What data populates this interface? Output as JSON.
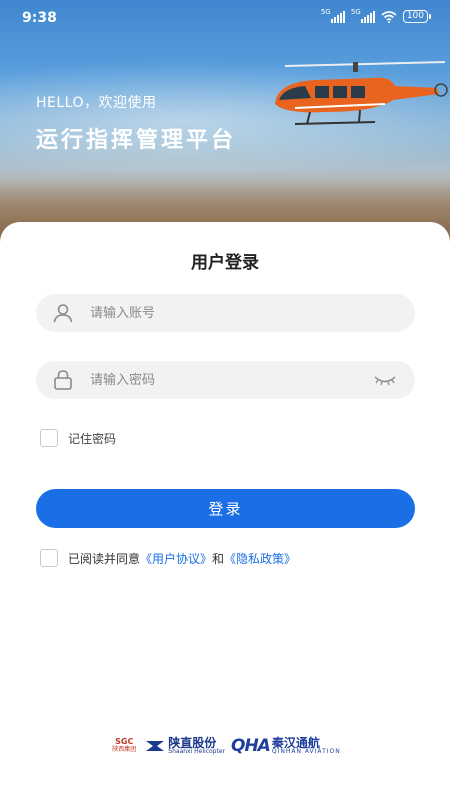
{
  "status_bar": {
    "time": "9:38",
    "network1": "5G",
    "network2": "5G",
    "battery": "100"
  },
  "hero": {
    "greeting": "HELLO，欢迎使用",
    "platform_title": "运行指挥管理平台"
  },
  "login": {
    "title": "用户登录",
    "account_placeholder": "请输入账号",
    "password_placeholder": "请输入密码",
    "remember_label": "记住密码",
    "submit_label": "登录",
    "agreement": {
      "prefix": "已阅读并同意",
      "user_agreement": "《用户协议》",
      "conjunction": "和",
      "privacy_policy": "《隐私政策》"
    }
  },
  "footer": {
    "logo1": {
      "text": "SGC",
      "sub": "陕西集团"
    },
    "logo2": {
      "cn": "陕直股份",
      "en": "Shaanxi Helicopter"
    },
    "logo3": {
      "mark": "QHA",
      "cn": "秦汉通航",
      "en": "QINHAN AVIATION"
    }
  },
  "colors": {
    "primary": "#1a6fe6",
    "field_bg": "#f2f2f2",
    "text": "#222222"
  }
}
